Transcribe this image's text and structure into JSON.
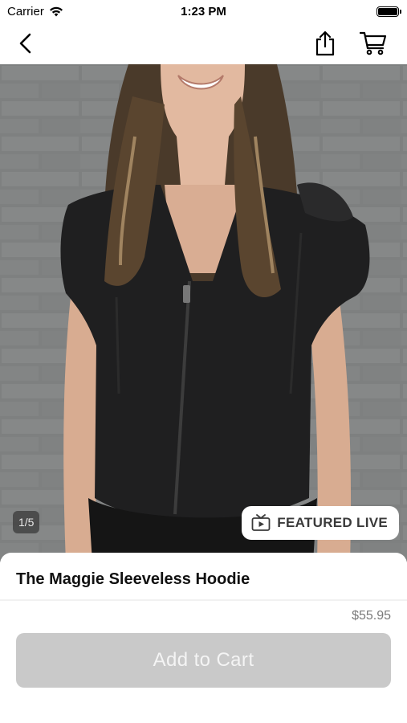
{
  "status_bar": {
    "carrier": "Carrier",
    "time": "1:23 PM"
  },
  "nav": {
    "back_icon": "chevron-left-icon",
    "share_icon": "share-icon",
    "cart_icon": "cart-icon"
  },
  "gallery": {
    "page_indicator": "1/5",
    "featured_badge": "FEATURED LIVE",
    "featured_icon": "tv-play-icon"
  },
  "product": {
    "title": "The Maggie Sleeveless Hoodie",
    "price": "$55.95",
    "add_to_cart_label": "Add to Cart"
  },
  "colors": {
    "button_disabled": "#c9c9c9",
    "price_text": "#7a7a7a"
  }
}
